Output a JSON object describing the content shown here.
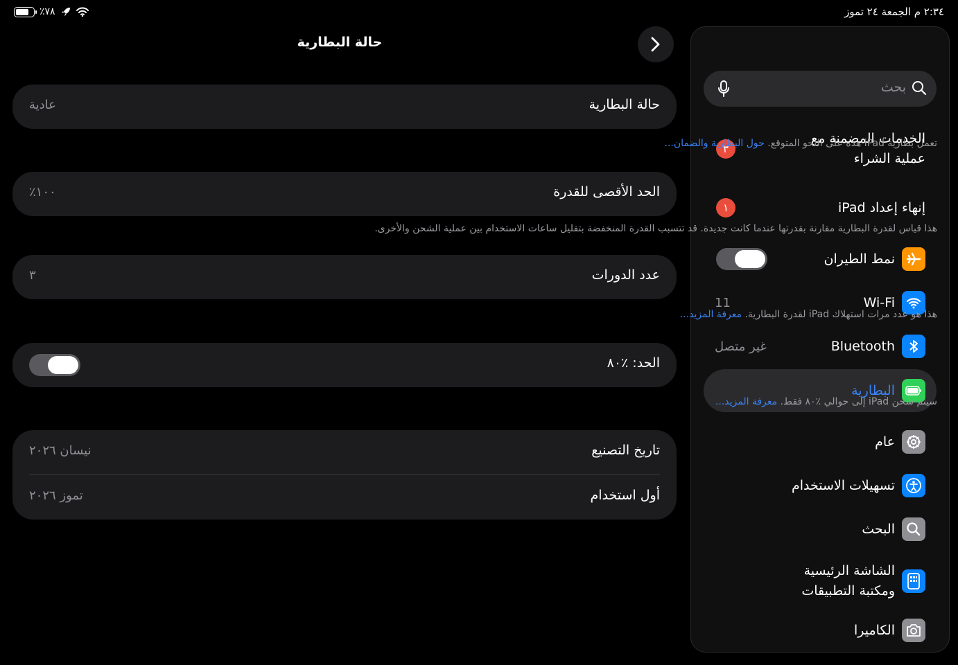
{
  "status": {
    "battery_percent": "٪٧٨",
    "battery_level": 0.78,
    "datetime": "٢:٣٤ م  الجمعة ٢٤ تموز"
  },
  "sidebar": {
    "search_placeholder": "بحث",
    "items": [
      {
        "label": "الخدمات المضمنة مع",
        "label2": "عملية الشراء",
        "badge": "٣"
      },
      {
        "label": "إنهاء إعداد iPad",
        "badge": "١"
      },
      {
        "label": "نمط الطيران",
        "icon": "airplane-icon",
        "color": "#ff9500",
        "toggle_on": false
      },
      {
        "label": "Wi-Fi",
        "icon": "wifi-icon",
        "color": "#0a84ff",
        "value": "11"
      },
      {
        "label": "Bluetooth",
        "icon": "bluetooth-icon",
        "color": "#0a84ff",
        "value": "غير متصل"
      },
      {
        "label": "البطارية",
        "icon": "battery-icon",
        "color": "#30d158",
        "selected": true
      },
      {
        "label": "عام",
        "icon": "gear-icon",
        "color": "#8e8e93"
      },
      {
        "label": "تسهيلات الاستخدام",
        "icon": "accessibility-icon",
        "color": "#0a84ff"
      },
      {
        "label": "البحث",
        "icon": "search-icon",
        "color": "#8e8e93"
      },
      {
        "label": "الشاشة الرئيسية",
        "label2": "ومكتبة التطبيقات",
        "icon": "home-screen-icon",
        "color": "#0a84ff"
      },
      {
        "label": "الكاميرا",
        "icon": "camera-icon",
        "color": "#8e8e93"
      }
    ]
  },
  "main": {
    "title": "حالة البطارية",
    "health": {
      "key": "حالة البطارية",
      "value": "عادية"
    },
    "health_note": "تعمل بطارية iPad هذه على النحو المتوقع.",
    "health_link": "حول البطارية والضمان...",
    "capacity": {
      "key": "الحد الأقصى للقدرة",
      "value": "٪١٠٠"
    },
    "capacity_note": "هذا قياس لقدرة البطارية مقارنة بقدرتها عندما كانت جديدة. قد تتسبب القدرة المنخفضة بتقليل ساعات الاستخدام بين عملية الشحن والأخرى.",
    "cycles": {
      "key": "عدد الدورات",
      "value": "٣"
    },
    "cycles_note": "هذا هو عدد مرات استهلاك iPad لقدرة البطارية.",
    "cycles_link": "معرفة المزيد...",
    "limit": {
      "key": "الحد: ٪٨٠",
      "toggle_on": false
    },
    "limit_note": "سيتم شحن iPad إلى حوالي ٪٨٠ فقط.",
    "limit_link": "معرفة المزيد...",
    "manufacture": {
      "key": "تاريخ التصنيع",
      "value": "نيسان ٢٠٢٦"
    },
    "first_use": {
      "key": "أول استخدام",
      "value": "تموز ٢٠٢٦"
    }
  }
}
